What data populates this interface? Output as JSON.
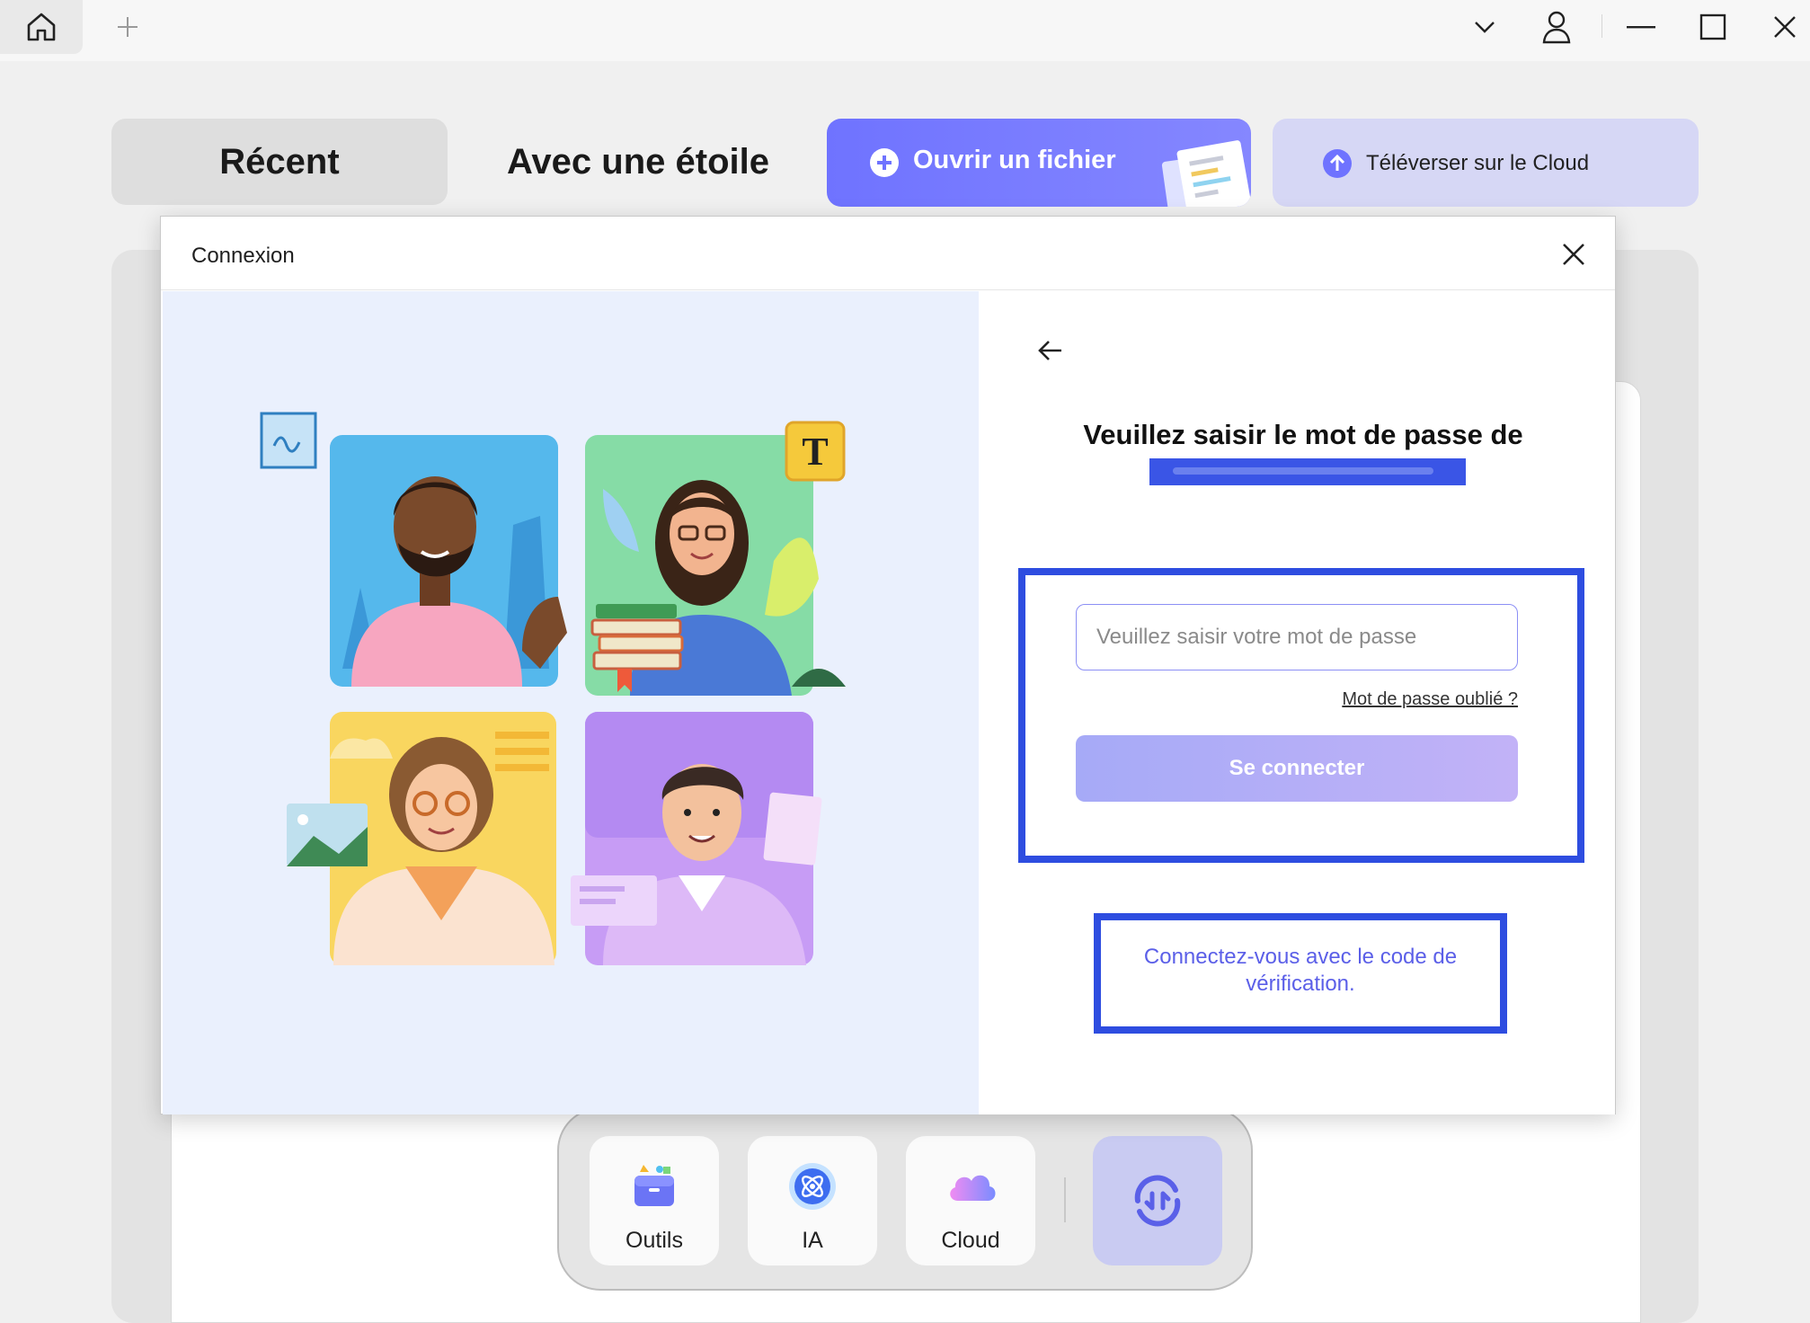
{
  "titlebar": {
    "home_icon": "home-icon",
    "new_tab_icon": "plus-icon",
    "dropdown_icon": "chevron-down-icon",
    "account_icon": "user-icon",
    "minimize_icon": "minimize-icon",
    "maximize_icon": "maximize-icon",
    "close_icon": "close-icon"
  },
  "tabs": {
    "recent": "Récent",
    "starred": "Avec une étoile",
    "open_file": "Ouvrir un fichier",
    "upload_cloud": "Téléverser sur le Cloud"
  },
  "dock": {
    "tools": "Outils",
    "ai": "IA",
    "cloud": "Cloud",
    "sync_icon": "sync-icon"
  },
  "dialog": {
    "title": "Connexion",
    "heading": "Veuillez saisir le mot de passe de",
    "password_placeholder": "Veuillez saisir votre mot de passe",
    "password_value": "",
    "forgot_password": "Mot de passe oublié ?",
    "login_button": "Se connecter",
    "verification_code_link": "Connectez-vous avec le code de vérification."
  },
  "colors": {
    "accent": "#6f73ff",
    "highlight_border": "#2e4de0",
    "link": "#5b5fe8",
    "illustration_bg": "#eaf0fd"
  }
}
